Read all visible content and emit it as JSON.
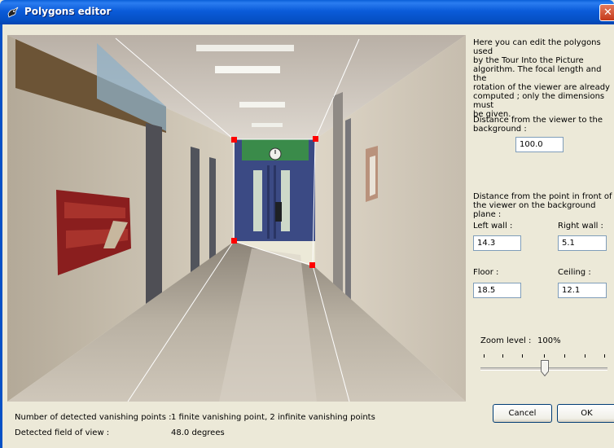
{
  "window": {
    "title": "Polygons editor",
    "close_glyph": "✕"
  },
  "panel": {
    "description": "Here you can edit the polygons used\nby the Tour Into the Picture\nalgorithm. The focal length and the\nrotation of the viewer are already\ncomputed ; only the dimensions must\nbe given.",
    "distance_background_label": "Distance from the viewer to the\nbackground :",
    "distance_background_value": "100.0",
    "distance_point_label": "Distance from the point in front of\nthe viewer on the background plane :",
    "left_wall_label": "Left wall :",
    "left_wall_value": "14.3",
    "right_wall_label": "Right wall :",
    "right_wall_value": "5.1",
    "floor_label": "Floor :",
    "floor_value": "18.5",
    "ceiling_label": "Ceiling :",
    "ceiling_value": "12.1",
    "zoom_label": "Zoom level :",
    "zoom_value": "100%",
    "zoom_level_fraction": 0.5
  },
  "buttons": {
    "cancel": "Cancel",
    "ok": "OK"
  },
  "status": {
    "vanishing_label": "Number of detected vanishing points :",
    "vanishing_value": "1 finite vanishing point, 2 infinite vanishing points",
    "fov_label": "Detected field of view :",
    "fov_value": "48.0 degrees"
  },
  "colors": {
    "titlebar": "#0651c6",
    "handle": "#ff0000",
    "polygon_line": "#ffffff"
  },
  "icons": {
    "title": "bird-app-icon",
    "close": "close-icon",
    "slider": "slider-thumb-icon"
  }
}
